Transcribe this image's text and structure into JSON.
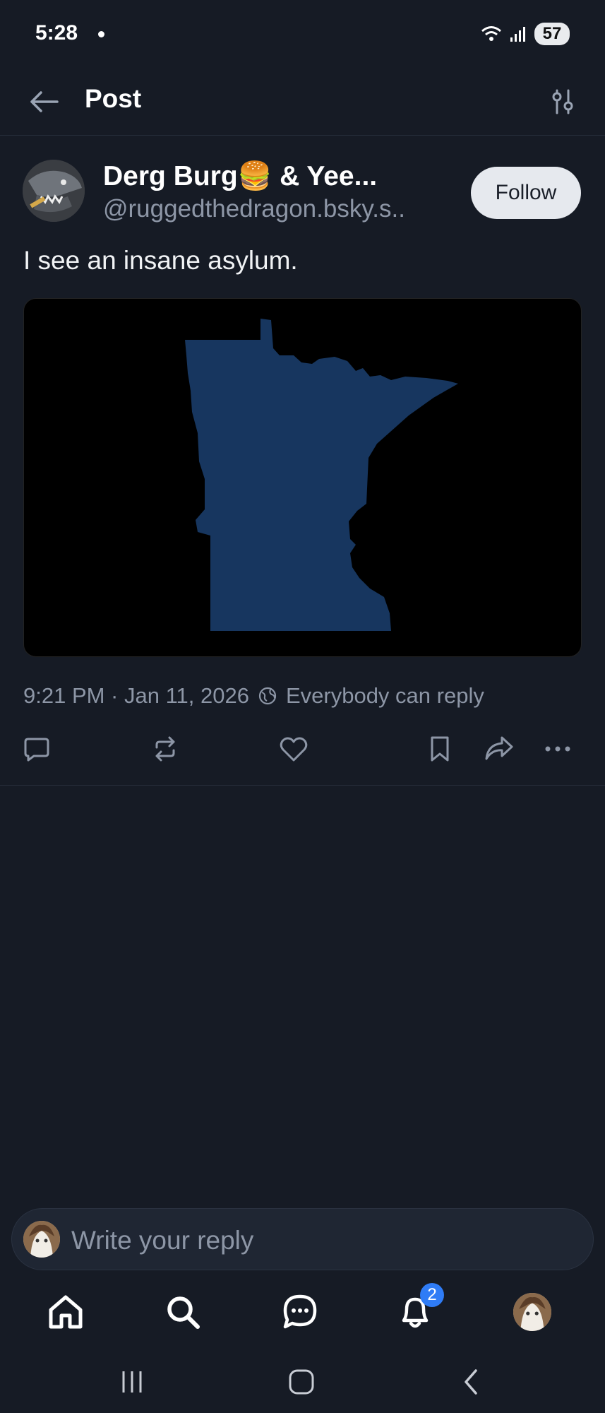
{
  "status_bar": {
    "time": "5:28",
    "battery": "57"
  },
  "header": {
    "title": "Post"
  },
  "post": {
    "author_name": "Derg Burg🍔 & Yee...",
    "author_handle": "@ruggedthedragon.bsky.s..",
    "follow_label": "Follow",
    "text": "I see an insane asylum.",
    "timestamp": "9:21 PM · Jan 11, 2026",
    "reply_setting": "Everybody can reply"
  },
  "reply": {
    "placeholder": "Write your reply"
  },
  "bottom_nav": {
    "notification_count": "2"
  },
  "colors": {
    "background": "#161b25",
    "accent": "#2f7cf6",
    "map_fill": "#17365f"
  }
}
